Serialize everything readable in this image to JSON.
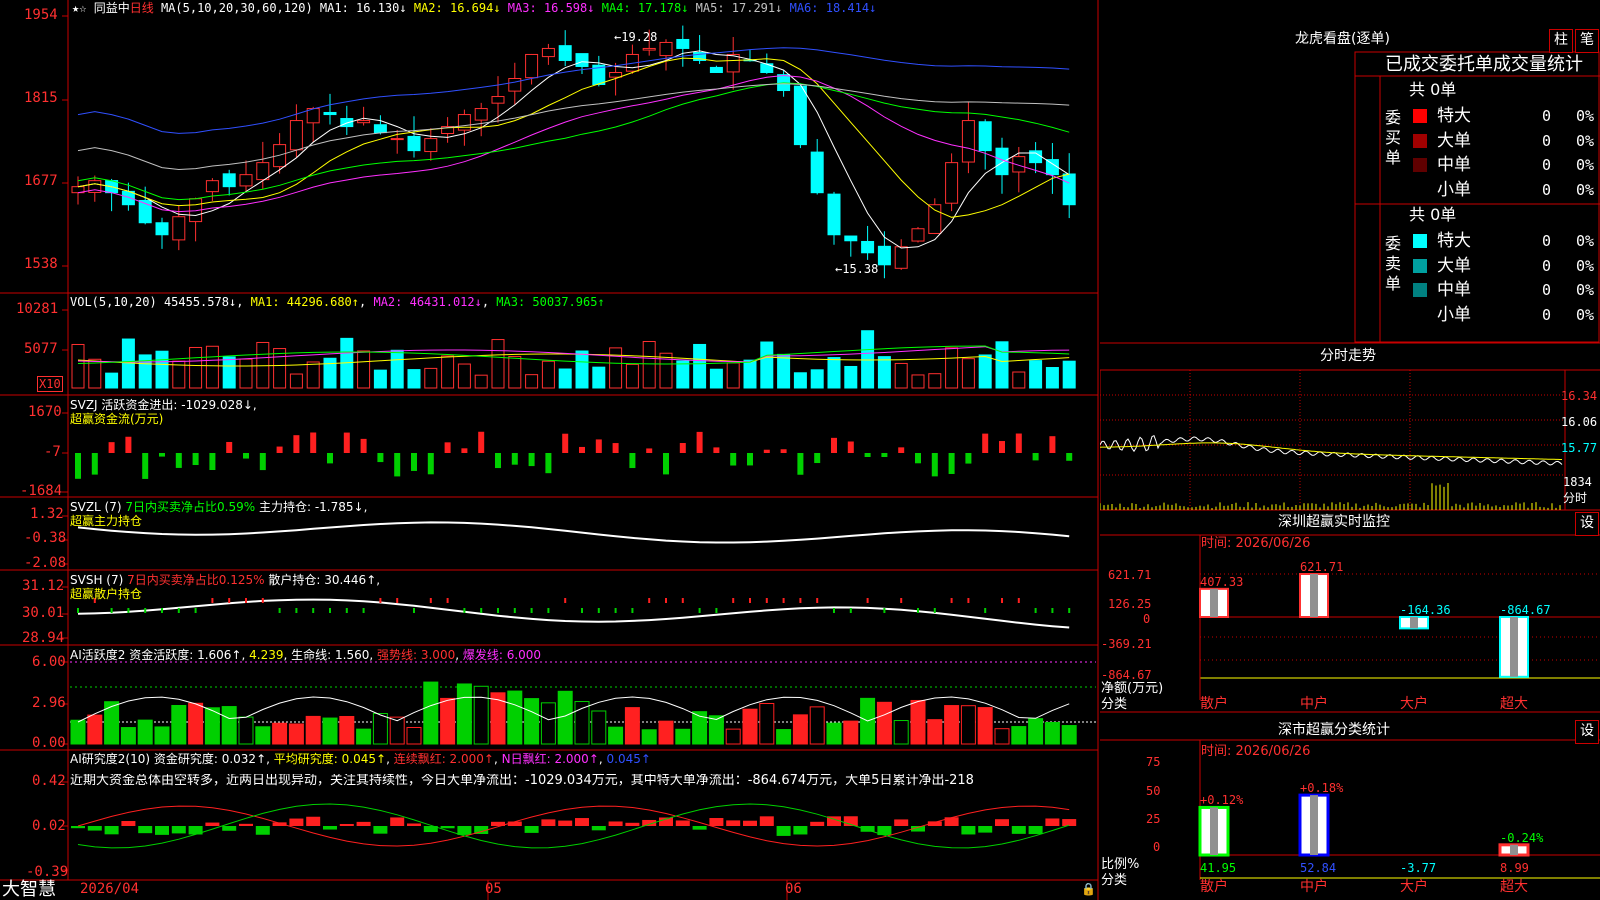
{
  "status_bar": {
    "app_name": "大智慧",
    "date_left": "2026/04",
    "month_may": "05",
    "month_jun": "06"
  },
  "kline": {
    "stock_name": "同益中",
    "period": "日线",
    "ma_label": "MA(5,10,20,30,60,120)",
    "ma1": "MA1: 16.130↓",
    "ma2": "MA2: 16.694↓",
    "ma3": "MA3: 16.598↓",
    "ma4": "MA4: 17.178↓",
    "ma5": "MA5: 17.291↓",
    "ma6": "MA6: 18.414↓",
    "y_labels": [
      "1954",
      "1815",
      "1677",
      "1538"
    ],
    "high_mark": "19.28",
    "low_mark": "15.38"
  },
  "vol": {
    "label": "VOL(5,10,20)",
    "value": "45455.578↓",
    "ma1": "MA1: 44296.680↑",
    "ma2": "MA2: 46431.012↓",
    "ma3": "MA3: 50037.965↑",
    "y_labels": [
      "10281",
      "5077"
    ],
    "unit": "X10"
  },
  "svzj": {
    "label": "SVZJ  活跃资金进出: -1029.028↓,",
    "sub": "超赢资金流(万元)",
    "y_labels": [
      "1670",
      "-7",
      "-1684"
    ]
  },
  "svzl": {
    "label": "SVZL (7)",
    "ratio": "7日内买卖净占比0.59%",
    "pos": "主力持仓: -1.785↓,",
    "sub": "超赢主力持仓",
    "y_labels": [
      "1.32",
      "-0.38",
      "-2.08"
    ]
  },
  "svsh": {
    "label": "SVSH (7)",
    "ratio": "7日内买卖净占比0.125%",
    "pos": "散户持仓: 30.446↑,",
    "sub": "超赢散户持仓",
    "y_labels": [
      "31.12",
      "30.01",
      "28.94"
    ]
  },
  "ai_act": {
    "label": "AI活跃度2",
    "v1": "资金活跃度: 1.606↑",
    "v2": "4.239",
    "v3": "生命线: 1.560",
    "v4": "强势线: 3.000",
    "v5": "爆发线: 6.000",
    "y_labels": [
      "6.00",
      "2.96",
      "0.00"
    ]
  },
  "ai_res": {
    "label": "AI研究度2(10)",
    "v1": "资金研究度: 0.032↑",
    "v2": "平均研究度: 0.045↑",
    "v3": "连续飘红: 2.000↑",
    "v4": "N日飘红: 2.000↑",
    "v5": "0.045↑",
    "comment": "近期大资金总体由空转多，近两日出现异动，关注其持续性，今日大单净流出：-1029.034万元，其中特大单净流出：-864.674万元，大单5日累计净出-218",
    "y_labels": [
      "0.42",
      "0.02",
      "-0.39"
    ]
  },
  "longhu": {
    "title": "龙虎看盘(逐单)",
    "btn1": "柱",
    "btn2": "笔",
    "table_title": "已成交委托单成交量统计",
    "buy_label": "委买单",
    "sell_label": "委卖单",
    "buy_total": "共 0单",
    "sell_total": "共 0单",
    "buy_rows": [
      {
        "name": "特大",
        "count": "0",
        "pct": "0%",
        "color": "#ff0000"
      },
      {
        "name": "大单",
        "count": "0",
        "pct": "0%",
        "color": "#a00000"
      },
      {
        "name": "中单",
        "count": "0",
        "pct": "0%",
        "color": "#600000"
      },
      {
        "name": "小单",
        "count": "0",
        "pct": "0%",
        "color": ""
      }
    ],
    "sell_rows": [
      {
        "name": "特大",
        "count": "0",
        "pct": "0%",
        "color": "#00ffff"
      },
      {
        "name": "大单",
        "count": "0",
        "pct": "0%",
        "color": "#00a0a0"
      },
      {
        "name": "中单",
        "count": "0",
        "pct": "0%",
        "color": "#008080"
      },
      {
        "name": "小单",
        "count": "0",
        "pct": "0%",
        "color": ""
      }
    ]
  },
  "intraday": {
    "title": "分时走势",
    "y_labels": [
      "16.34",
      "16.06",
      "15.77",
      "1834"
    ],
    "vol_unit": "分时"
  },
  "sz_monitor": {
    "title": "深圳超赢实时监控",
    "settings": "设",
    "time": "时间: 2026/06/26",
    "y_labels": [
      "621.71",
      "126.25",
      "0",
      "-369.21",
      "-864.67"
    ],
    "unit1": "净额(万元)",
    "unit2": "分类",
    "bars": [
      {
        "name": "散户",
        "value": 407.33,
        "label": "407.33"
      },
      {
        "name": "中户",
        "value": 621.71,
        "label": "621.71"
      },
      {
        "name": "大户",
        "value": -164.36,
        "label": "-164.36"
      },
      {
        "name": "超大",
        "value": -864.67,
        "label": "-864.67"
      }
    ]
  },
  "sz_class": {
    "title": "深市超赢分类统计",
    "settings": "设",
    "time": "时间: 2026/06/26",
    "y_labels": [
      "75",
      "50",
      "25",
      "0"
    ],
    "unit1": "比例%",
    "unit2": "分类",
    "bars": [
      {
        "name": "散户",
        "value": 41.95,
        "value_label": "41.95",
        "change": "+0.12%"
      },
      {
        "name": "中户",
        "value": 52.84,
        "value_label": "52.84",
        "change": "+0.18%"
      },
      {
        "name": "大户",
        "value": -3.77,
        "value_label": "-3.77",
        "change": ""
      },
      {
        "name": "超大",
        "value": 8.99,
        "value_label": "8.99",
        "change": "-0.24%"
      }
    ]
  }
}
